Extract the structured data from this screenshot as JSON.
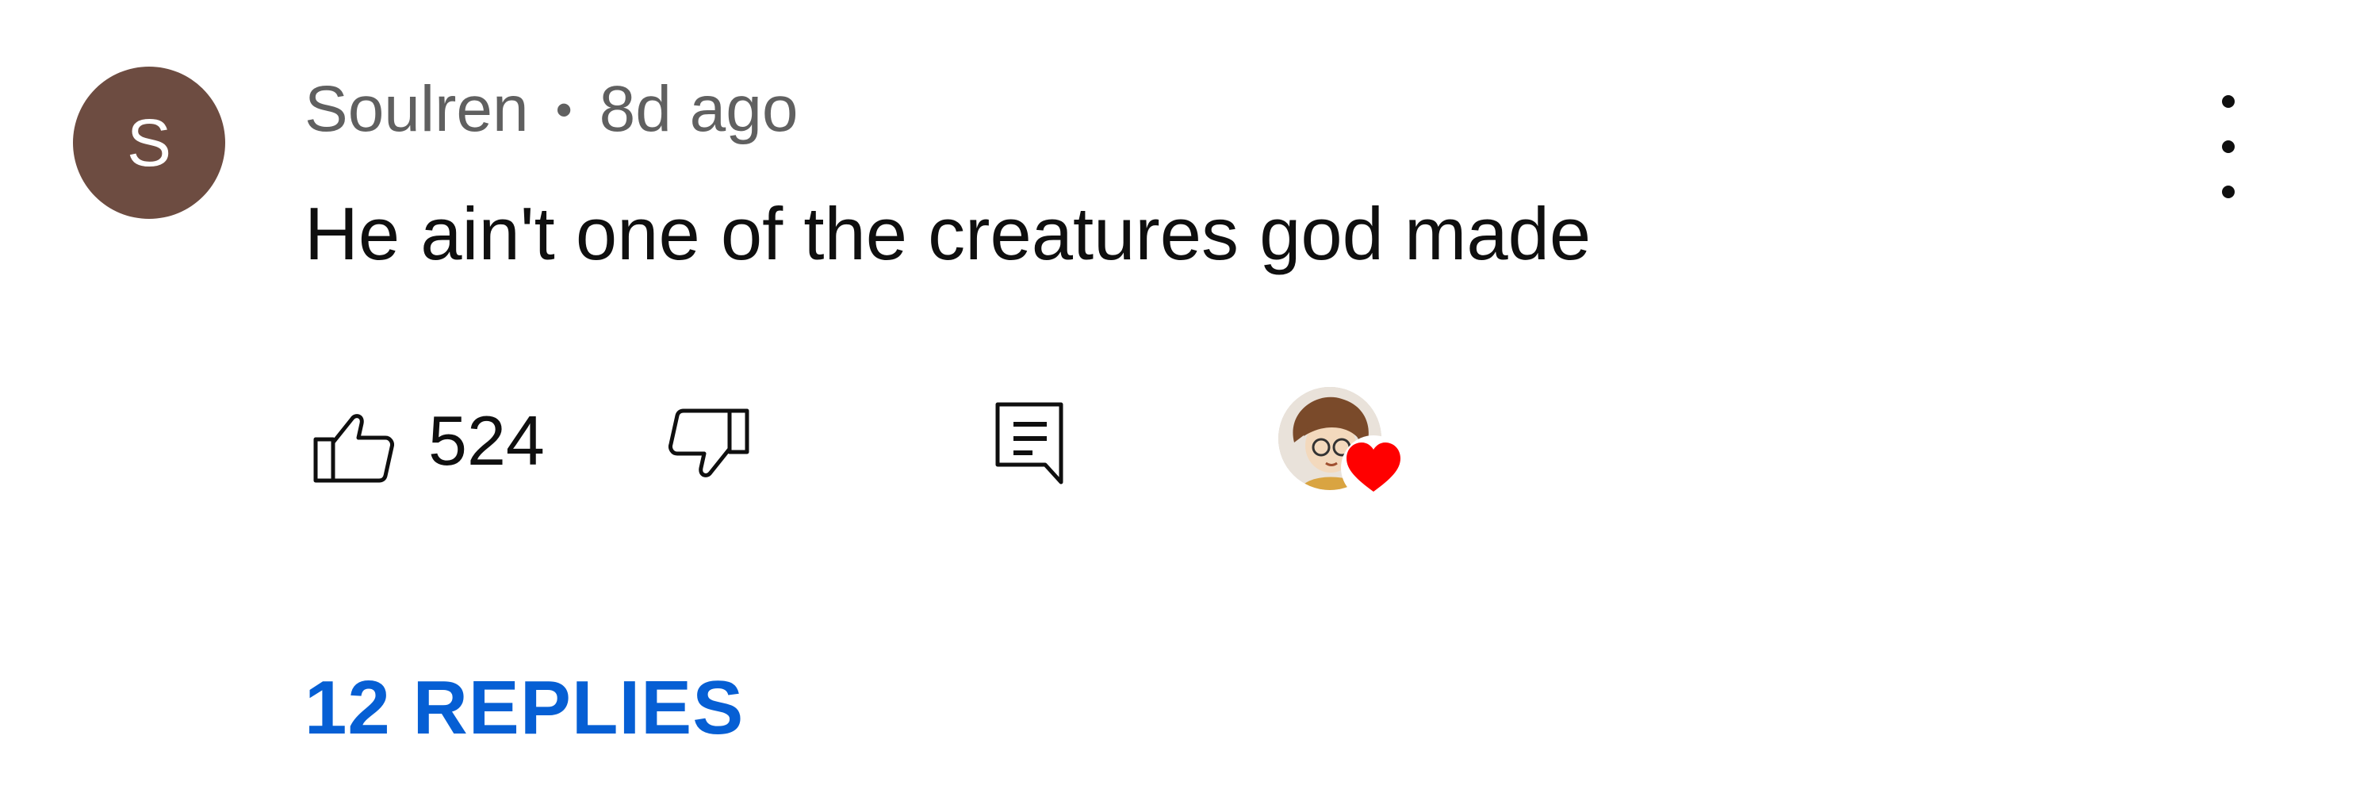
{
  "comment": {
    "author_initial": "S",
    "author": "Soulren",
    "separator": "•",
    "timestamp": "8d ago",
    "text": "He ain't one of the creatures god made",
    "like_count": "524",
    "replies_label": "12 REPLIES",
    "avatar_color": "#6d4c41",
    "link_color": "#065fd4",
    "heart_color": "#ff0000"
  },
  "icons": {
    "like": "thumbs-up-icon",
    "dislike": "thumbs-down-icon",
    "reply": "reply-comment-icon",
    "more": "more-vert-icon",
    "creator_heart": "creator-heart-badge"
  }
}
